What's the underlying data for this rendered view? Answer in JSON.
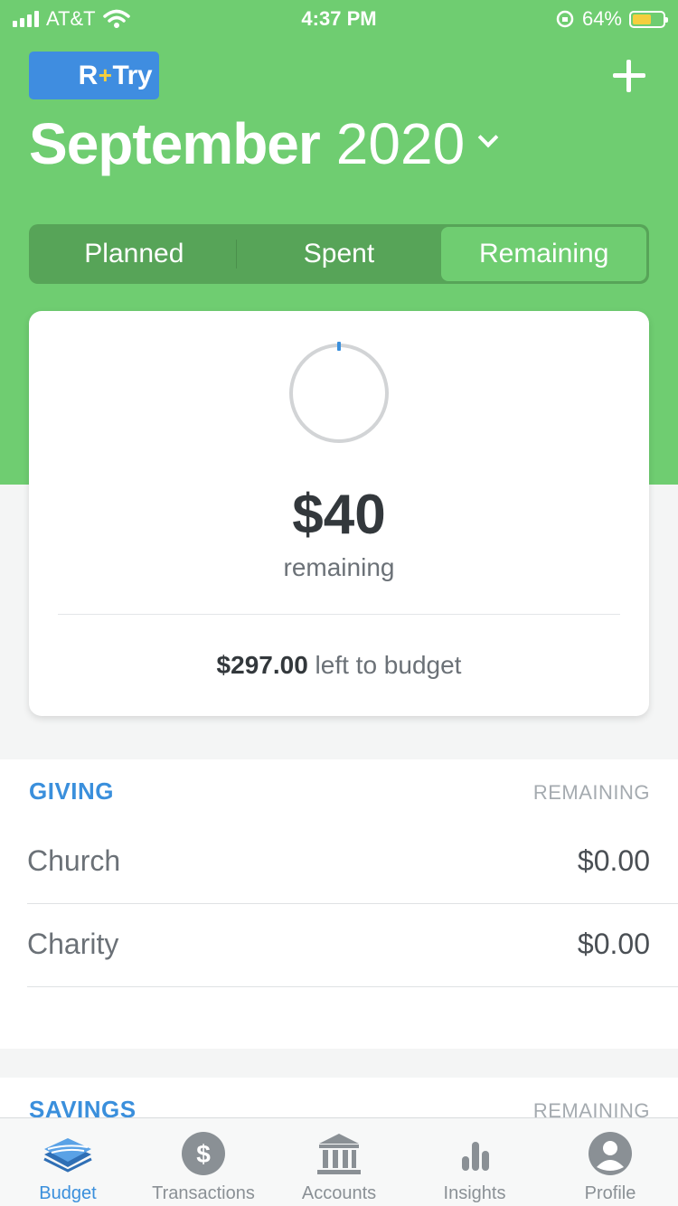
{
  "status_bar": {
    "carrier": "AT&T",
    "time": "4:37 PM",
    "battery": "64%"
  },
  "header": {
    "try_badge_r": "R",
    "try_badge_plus": "+",
    "try_badge_text": "Try",
    "month": "September",
    "year": "2020"
  },
  "segments": [
    {
      "label": "Planned",
      "active": false
    },
    {
      "label": "Spent",
      "active": false
    },
    {
      "label": "Remaining",
      "active": true
    }
  ],
  "summary": {
    "amount": "$40",
    "label": "remaining",
    "left_amount": "$297.00",
    "left_label": "left to budget"
  },
  "giving": {
    "title": "GIVING",
    "column": "REMAINING",
    "items": [
      {
        "name": "Church",
        "amount": "$0.00"
      },
      {
        "name": "Charity",
        "amount": "$0.00"
      }
    ]
  },
  "savings": {
    "title": "SAVINGS",
    "column": "REMAINING"
  },
  "tabbar": [
    {
      "label": "Budget",
      "icon": "budget-icon",
      "active": true
    },
    {
      "label": "Transactions",
      "icon": "dollar-icon",
      "active": false
    },
    {
      "label": "Accounts",
      "icon": "bank-icon",
      "active": false
    },
    {
      "label": "Insights",
      "icon": "bar-chart-icon",
      "active": false
    },
    {
      "label": "Profile",
      "icon": "profile-icon",
      "active": false
    }
  ],
  "colors": {
    "brand_green": "#6fcd71",
    "segment_dark": "#57a458",
    "accent_blue": "#3a8fdc",
    "badge_yellow": "#f5cf3e"
  }
}
